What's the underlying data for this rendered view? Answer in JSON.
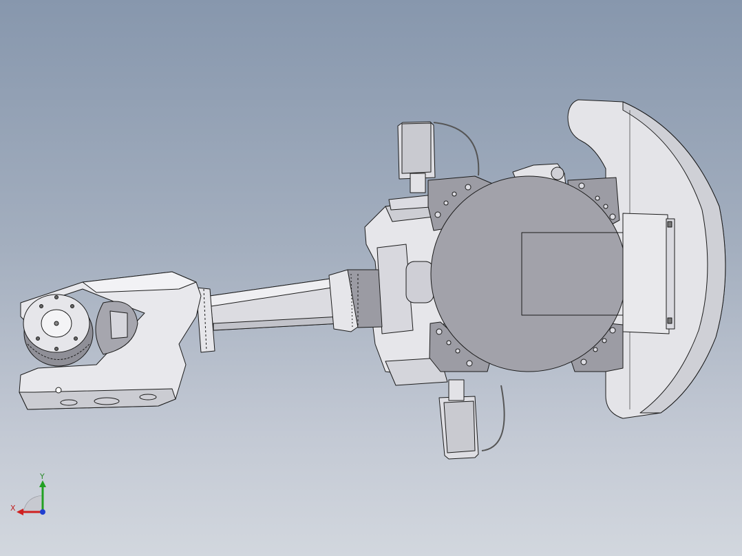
{
  "viewport": {
    "background_top": "#8797ad",
    "background_bottom": "#d2d7de",
    "model_fill": "#e9e9ec",
    "model_shade": "#c9c9cf",
    "model_dark": "#8e8e96",
    "flange_fill": "#9b9ba3",
    "edge_color": "#1a1a1a"
  },
  "triad": {
    "x_axis_label": "X",
    "y_axis_label": "Y",
    "x_color": "#d02020",
    "y_color": "#22a022",
    "z_color": "#1f3fd0"
  }
}
